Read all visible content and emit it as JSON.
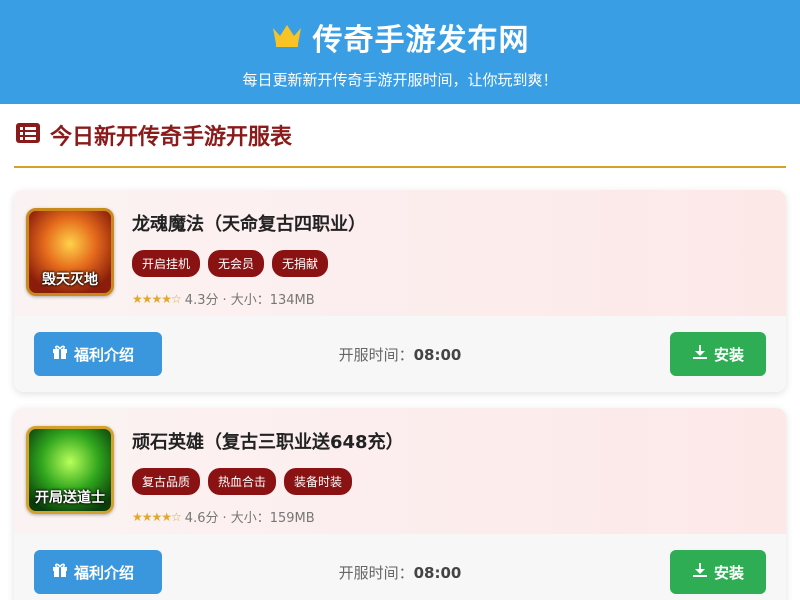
{
  "header": {
    "title": "传奇手游发布网",
    "subtitle": "每日更新新开传奇手游开服时间，让你玩到爽！",
    "crown_color": "#f7c325"
  },
  "section": {
    "title": "今日新开传奇手游开服表",
    "icon": "list-icon"
  },
  "games": [
    {
      "name": "龙魂魔法（天命复古四职业）",
      "thumb_text": "毁天灭地",
      "tags": [
        "开启挂机",
        "无会员",
        "无捐献"
      ],
      "rating_stars": 4,
      "rating": "4.3分",
      "size": "· 大小：134MB",
      "welfare_label": "福利介绍",
      "open_time_label": "开服时间：",
      "open_time": "08:00",
      "install_label": "安装"
    },
    {
      "name": "顽石英雄（复古三职业送648充）",
      "thumb_text": "开局送道士",
      "tags": [
        "复古品质",
        "热血合击",
        "装备时装"
      ],
      "rating_stars": 4,
      "rating": "4.6分",
      "size": "· 大小：159MB",
      "welfare_label": "福利介绍",
      "open_time_label": "开服时间：",
      "open_time": "08:00",
      "install_label": "安装"
    }
  ]
}
